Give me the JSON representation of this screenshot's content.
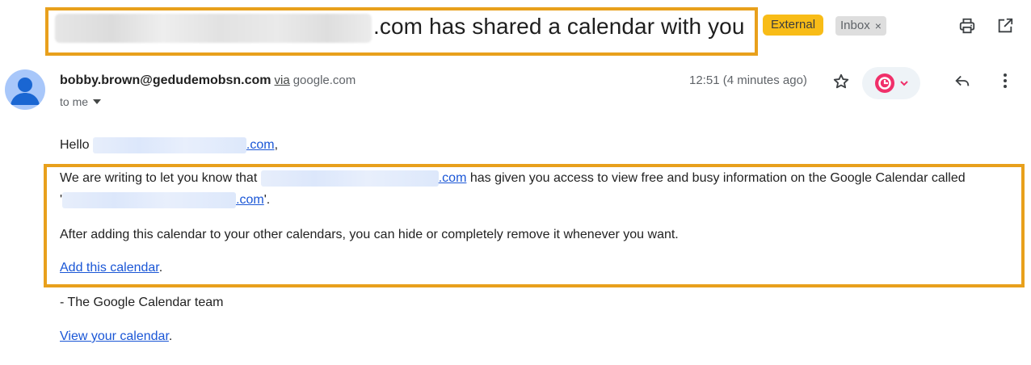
{
  "subject": {
    "text": ".com has shared a calendar with you",
    "labels": {
      "external": "External",
      "inbox": "Inbox",
      "inbox_remove": "×"
    },
    "actions": {
      "print_icon": "print-icon",
      "open_new_window_icon": "open-in-new-window-icon"
    }
  },
  "message": {
    "sender_email": "bobby.brown@gedudemobsn.com",
    "via_label": "via",
    "via_domain": "google.com",
    "recipient": "to me",
    "timestamp": "12:51 (4 minutes ago)",
    "icons": [
      "star-icon",
      "snooze-clock-icon",
      "reply-icon",
      "more-vert-icon"
    ],
    "colors": {
      "accent_pink": "#f0306a",
      "highlight_orange": "#e8a01c",
      "link_blue": "#1a56d6",
      "external_badge": "#f8bc17"
    }
  },
  "body": {
    "greeting_prefix": "Hello",
    "greeting_link_tail": ".com",
    "greeting_suffix": ",",
    "p1_start": "We are writing to let you know that",
    "p1_link_tail": ".com",
    "p1_rest": "has given you access to view free and busy information on the Google Calendar called",
    "p1_quote_open": "'",
    "p1_line2_link_tail": ".com",
    "p1_quote_close": "'.",
    "p2": "After adding this calendar to your other calendars, you can hide or completely remove it whenever you want.",
    "add_link": "Add this calendar",
    "add_link_period": ".",
    "signoff": "- The Google Calendar team",
    "view_link": "View your calendar",
    "view_link_period": "."
  }
}
